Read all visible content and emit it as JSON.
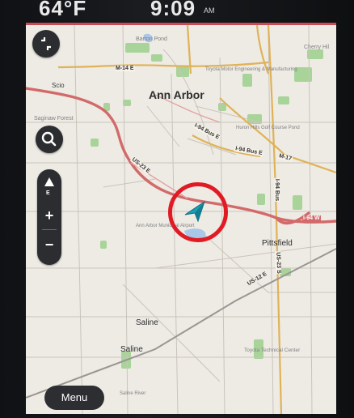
{
  "status_bar": {
    "temperature": "64°F",
    "time": "9:09",
    "ampm": "AM"
  },
  "map_labels": {
    "city": "Ann Arbor",
    "pittsfield": "Pittsfield",
    "saline_upper": "Saline",
    "saline_lower": "Saline",
    "scio": "Scio",
    "saginaw_forest": "Saginaw Forest",
    "barton_pond": "Barton Pond",
    "toyota_engineering": "Toyota Motor Engineering & Manufacturing",
    "cherry_hill": "Cherry Hil",
    "huron_hills": "Huron Hills Golf Course Pond",
    "airport": "Ann Arbor Municipal Airport",
    "toyota_tech": "Toyota Technical Center",
    "saline_river": "Saline River"
  },
  "road_labels": {
    "m14_e": "M-14 E",
    "i94_bus_e_left": "I-94 Bus E",
    "i94_bus_e_right": "I-94 Bus E",
    "m17": "M-17",
    "us23_e": "US-23 E",
    "i94_w": "I-94 W",
    "i94_bus_vertical": "I-94 Bus",
    "us12_e": "US-12 E",
    "us23_s": "US-23 S"
  },
  "controls": {
    "compass_letter": "E",
    "zoom_in": "+",
    "zoom_out": "−",
    "menu": "Menu"
  },
  "colors": {
    "highway": "#d36a6a",
    "major_road": "#e0b257",
    "minor_road": "#c9c4bb",
    "park": "#a8d49a",
    "water": "#a9c7e8",
    "highlight_ring": "#e01b24",
    "vehicle": "#1a9fb4"
  }
}
